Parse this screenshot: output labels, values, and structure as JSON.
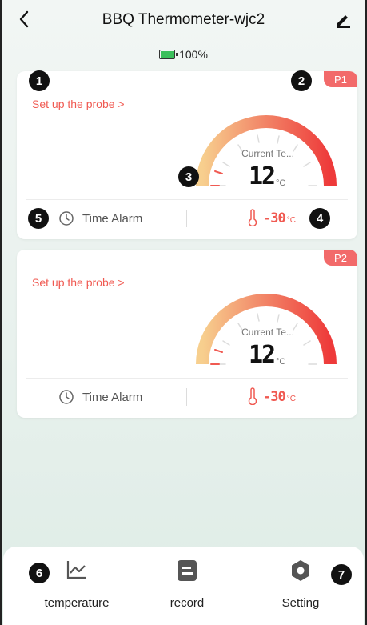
{
  "header": {
    "title": "BBQ Thermometer-wjc2"
  },
  "battery": {
    "level_text": "100%",
    "level_fraction": 1.0,
    "color": "#3bbf5b"
  },
  "probes": [
    {
      "tag": "P1",
      "setup_link": "Set up the probe >",
      "gauge_label": "Current Te...",
      "current_temp": "12",
      "temp_unit": "°C",
      "alarm_label": "Time Alarm",
      "low_temp": "-30",
      "low_unit": "°C"
    },
    {
      "tag": "P2",
      "setup_link": "Set up the probe >",
      "gauge_label": "Current Te...",
      "current_temp": "12",
      "temp_unit": "°C",
      "alarm_label": "Time Alarm",
      "low_temp": "-30",
      "low_unit": "°C"
    }
  ],
  "callouts": [
    "1",
    "2",
    "3",
    "4",
    "5",
    "6",
    "7"
  ],
  "nav": {
    "temperature": "temperature",
    "record": "record",
    "setting": "Setting"
  },
  "colors": {
    "accent": "#f05a52",
    "tag": "#f26a6a",
    "gauge_start": "#f7c98a",
    "gauge_end": "#ee3a3a",
    "nav_icon": "#555555"
  },
  "icons": {
    "back": "chevron-left-icon",
    "edit": "pencil-icon",
    "battery": "battery-icon",
    "clock": "clock-icon",
    "thermometer": "thermometer-icon",
    "chart": "line-chart-icon",
    "record": "record-icon",
    "gear": "gear-icon"
  }
}
